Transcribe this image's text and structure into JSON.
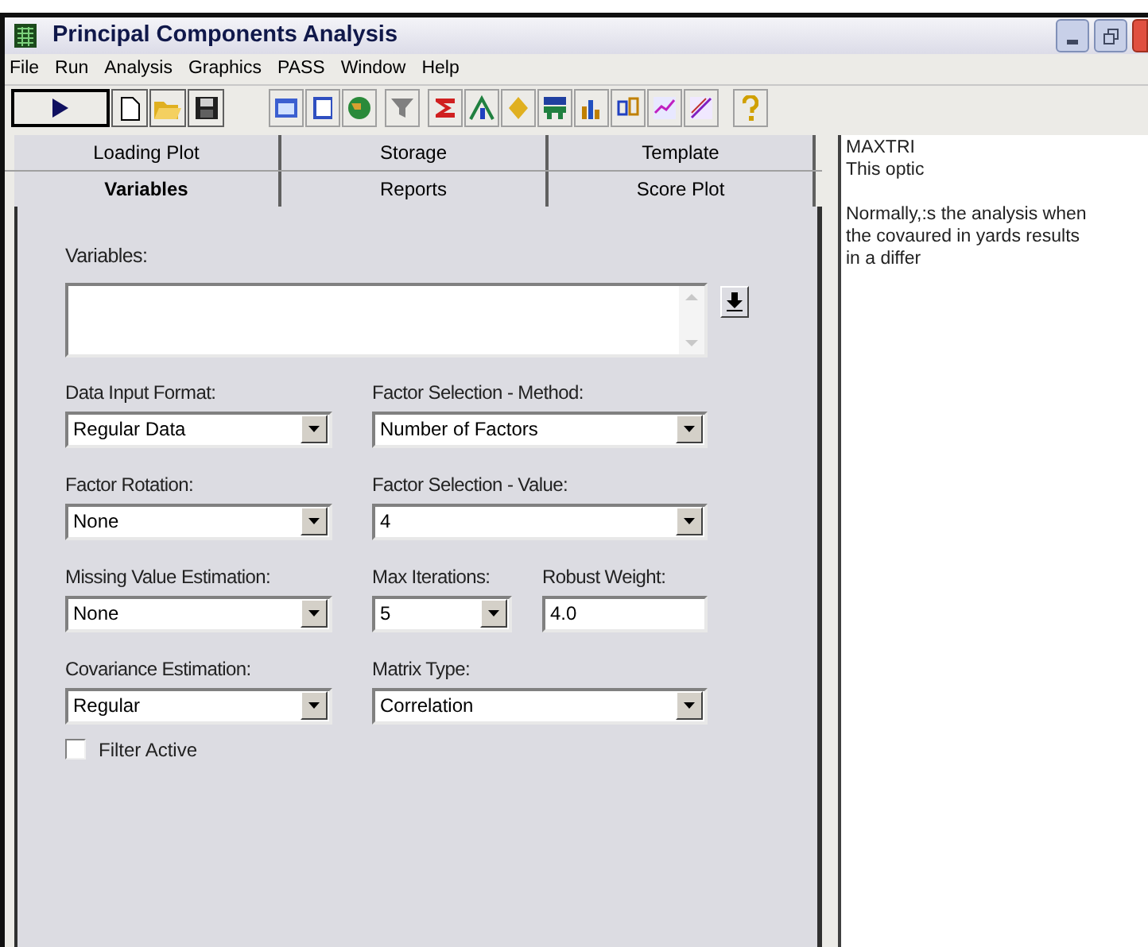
{
  "window": {
    "title": "Principal Components Analysis"
  },
  "menu": [
    "File",
    "Run",
    "Analysis",
    "Graphics",
    "PASS",
    "Window",
    "Help"
  ],
  "tabs": {
    "back_row": [
      {
        "label": "Loading Plot",
        "selected": false
      },
      {
        "label": "Storage",
        "selected": false
      },
      {
        "label": "Template",
        "selected": false
      }
    ],
    "front_row": [
      {
        "label": "Variables",
        "selected": true
      },
      {
        "label": "Reports",
        "selected": false
      },
      {
        "label": "Score Plot",
        "selected": false
      }
    ]
  },
  "variables": {
    "label": "Variables:"
  },
  "fields": [
    {
      "label": "Data Input Format:",
      "kind": "dropdown",
      "value": "Regular Data"
    },
    {
      "label": "Factor Selection - Method:",
      "kind": "dropdown",
      "value": "Number of Factors"
    },
    {
      "label": "Factor Rotation:",
      "kind": "dropdown",
      "value": "None"
    },
    {
      "label": "Factor Selection - Value:",
      "kind": "dropdown",
      "value": "4"
    },
    {
      "label": "Missing Value Estimation:",
      "kind": "dropdown",
      "value": "None"
    },
    {
      "label": "Max Iterations:",
      "kind": "dropdown",
      "value": "5"
    },
    {
      "label": "Robust Weight:",
      "kind": "text",
      "value": "4.0"
    },
    {
      "label": "Covariance Estimation:",
      "kind": "dropdown",
      "value": "Regular"
    },
    {
      "label": "Matrix Type:",
      "kind": "dropdown",
      "value": "Correlation"
    }
  ],
  "filter_active": {
    "label": "Filter Active",
    "checked": false
  },
  "help": {
    "paragraphs": [
      [
        "MAXTRI",
        "This optic"
      ],
      [
        "Normally,:s the analysis when",
        "the covaured in yards results",
        "in a differ"
      ]
    ]
  }
}
